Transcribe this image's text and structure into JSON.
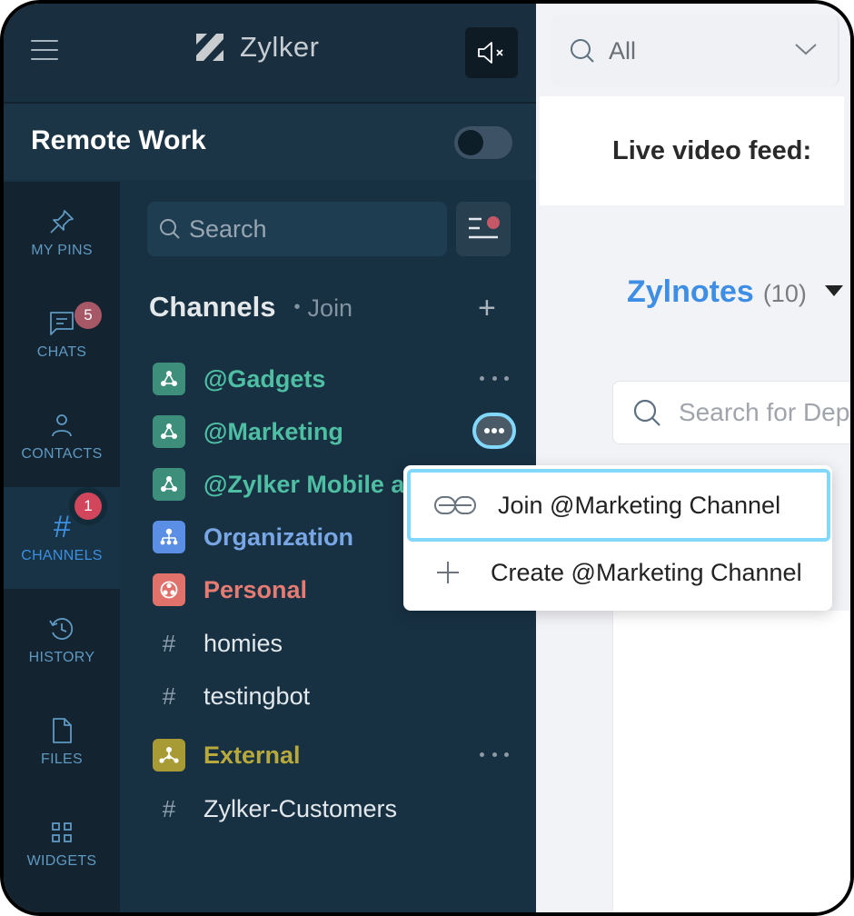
{
  "app": {
    "brand_name": "Zylker",
    "workspace_name": "Remote Work",
    "workspace_toggle_on": false,
    "mute_icon": "speaker-muted-icon"
  },
  "rail": {
    "items": [
      {
        "id": "pins",
        "label": "MY PINS",
        "icon": "pin-icon",
        "badge": null,
        "active": false
      },
      {
        "id": "chats",
        "label": "CHATS",
        "icon": "chat-icon",
        "badge": "5",
        "active": false
      },
      {
        "id": "contacts",
        "label": "CONTACTS",
        "icon": "person-icon",
        "badge": null,
        "active": false
      },
      {
        "id": "channels",
        "label": "CHANNELS",
        "icon": "hash-icon",
        "badge": "1",
        "active": true
      },
      {
        "id": "history",
        "label": "HISTORY",
        "icon": "history-icon",
        "badge": null,
        "active": false
      },
      {
        "id": "files",
        "label": "FILES",
        "icon": "file-icon",
        "badge": null,
        "active": false
      },
      {
        "id": "widgets",
        "label": "WIDGETS",
        "icon": "grid-icon",
        "badge": null,
        "active": false
      }
    ]
  },
  "channels_panel": {
    "search_placeholder": "Search",
    "section_title": "Channels",
    "section_join": "Join",
    "add_label": "+",
    "items": [
      {
        "name": "@Gadgets",
        "kind": "team",
        "color": "#4fbfa4",
        "icon_bg": "#3d8f7c",
        "more": true,
        "more_active": false
      },
      {
        "name": "@Marketing",
        "kind": "team",
        "color": "#4fbfa4",
        "icon_bg": "#3d8f7c",
        "more": true,
        "more_active": true
      },
      {
        "name": "@Zylker Mobile app",
        "kind": "team",
        "color": "#4fbfa4",
        "icon_bg": "#3d8f7c",
        "more": false,
        "more_active": false
      },
      {
        "name": "Organization",
        "kind": "org",
        "color": "#79a7e6",
        "icon_bg": "#5b8fe6",
        "more": false,
        "more_active": false
      },
      {
        "name": "Personal",
        "kind": "personal",
        "color": "#e67b73",
        "icon_bg": "#e0716b",
        "more": false,
        "more_active": false
      },
      {
        "name": "homies",
        "kind": "hash",
        "color": "#e3e8ec",
        "icon_bg": null,
        "more": false,
        "more_active": false
      },
      {
        "name": "testingbot",
        "kind": "hash",
        "color": "#e3e8ec",
        "icon_bg": null,
        "more": false,
        "more_active": false
      },
      {
        "name": "External",
        "kind": "external",
        "color": "#b8a93c",
        "icon_bg": "#a89b36",
        "more": true,
        "more_active": false
      },
      {
        "name": "Zylker-Customers",
        "kind": "hash",
        "color": "#e3e8ec",
        "icon_bg": null,
        "more": false,
        "more_active": false
      }
    ]
  },
  "context_menu": {
    "items": [
      {
        "label": "Join @Marketing Channel",
        "icon": "link-icon",
        "focused": true
      },
      {
        "label": "Create @Marketing Channel",
        "icon": "plus-icon",
        "focused": false
      }
    ]
  },
  "right_pane": {
    "filter_value": "All",
    "video_title": "Live video feed:",
    "zylnotes_name": "Zylnotes",
    "zylnotes_count": "(10)",
    "dep_search_placeholder": "Search for Dep"
  }
}
